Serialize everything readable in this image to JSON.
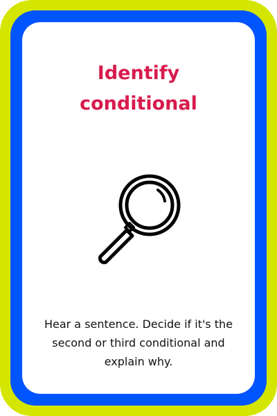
{
  "card": {
    "title_line1": "Identify",
    "title_line2": "conditional",
    "icon": "magnifying-glass-icon",
    "description": "Hear a sentence. Decide if it's the second or third conditional and explain why.",
    "colors": {
      "outer_border": "#d4e600",
      "inner_border": "#0055ff",
      "title": "#d81b4d"
    }
  }
}
